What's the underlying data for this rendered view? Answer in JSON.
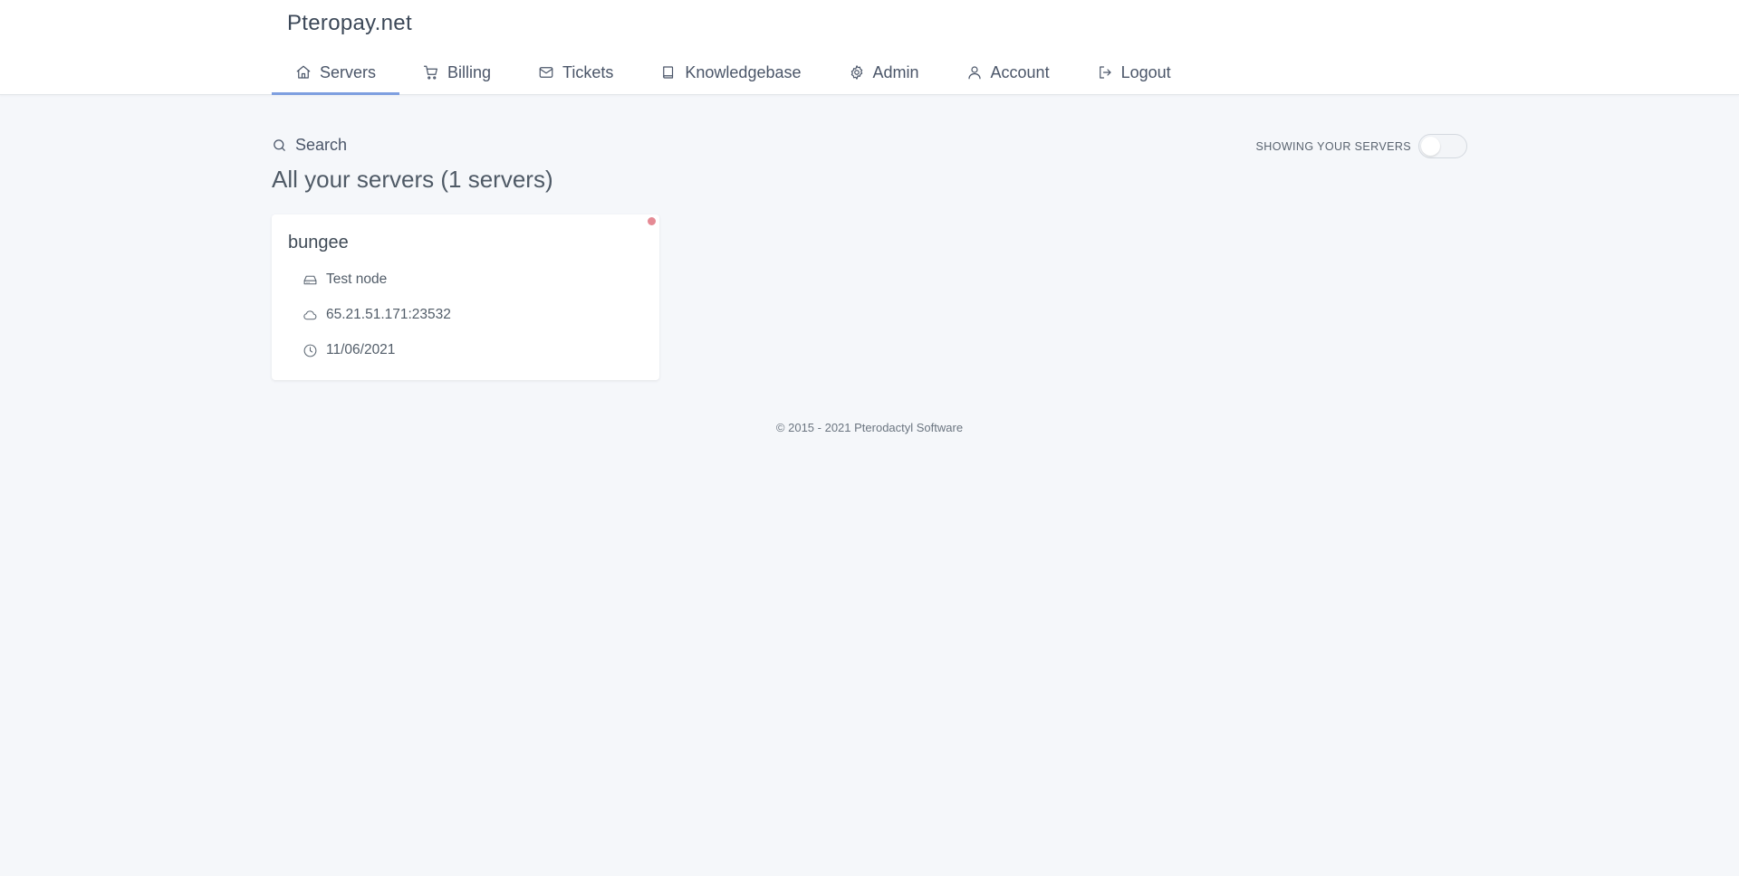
{
  "header": {
    "brand": "Pteropay.net",
    "nav": [
      {
        "label": "Servers",
        "icon": "home-icon",
        "active": true
      },
      {
        "label": "Billing",
        "icon": "cart-icon"
      },
      {
        "label": "Tickets",
        "icon": "mail-icon"
      },
      {
        "label": "Knowledgebase",
        "icon": "book-icon"
      },
      {
        "label": "Admin",
        "icon": "gear-icon"
      },
      {
        "label": "Account",
        "icon": "user-icon"
      },
      {
        "label": "Logout",
        "icon": "logout-icon"
      }
    ]
  },
  "toolbar": {
    "search_label": "Search",
    "toggle_label": "SHOWING YOUR SERVERS",
    "toggle_on": false
  },
  "main": {
    "title": "All your servers (1 servers)",
    "servers": [
      {
        "name": "bungee",
        "node": "Test node",
        "address": "65.21.51.171:23532",
        "date": "11/06/2021",
        "status_color": "#e58a94"
      }
    ]
  },
  "footer": {
    "text": "© 2015 - 2021 Pterodactyl Software"
  },
  "colors": {
    "accent": "#7e9fe0",
    "background": "#f5f7fa",
    "status_offline": "#e58a94"
  }
}
